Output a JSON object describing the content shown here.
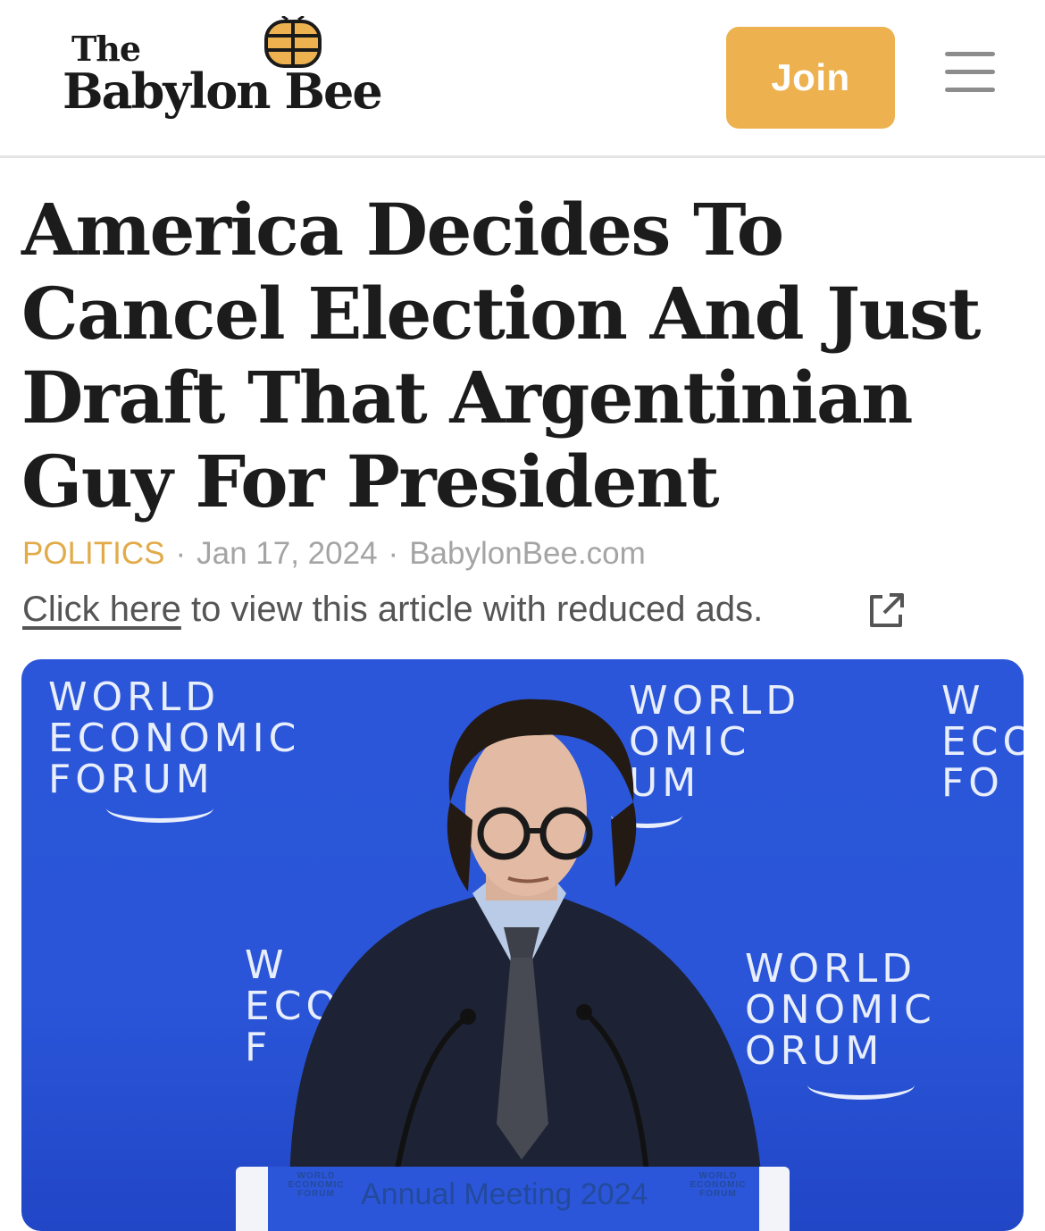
{
  "header": {
    "logo_small": "The",
    "logo_main": "Babylon Bee",
    "join_label": "Join"
  },
  "article": {
    "headline": "America Decides To Cancel Election And Just Draft That Argentinian Guy For President",
    "category": "POLITICS",
    "separator": "·",
    "date": "Jan 17, 2024",
    "source": "BabylonBee.com",
    "reduced_ads_link": "Click here",
    "reduced_ads_text": " to view this article with reduced ads."
  },
  "photo": {
    "wef_left": "WORLD\nECONOMIC\nFORUM",
    "wef_center": "WORLD\nOMIC\nUM",
    "wef_right_top": "W\nECO\nFO",
    "wef_mid_left": "W\nECO\nF",
    "wef_mid_right": "WORLD\nONOMIC\nORUM",
    "podium_caption": "Annual Meeting 2024",
    "podium_badge": "WORLD ECONOMIC FORUM"
  },
  "colors": {
    "join": "#edb24f",
    "category": "#e2ab4a",
    "wef_blue": "#2b56d9"
  }
}
